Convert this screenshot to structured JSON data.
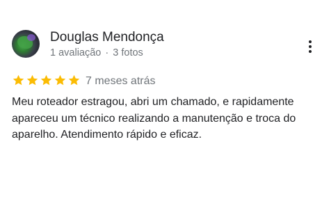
{
  "reviewer": {
    "name": "Douglas Mendonça",
    "reviews": "1 avaliação",
    "separator": "·",
    "photos": "3 fotos"
  },
  "rating": {
    "stars": 5,
    "max": 5,
    "star_color": "#fbbc04"
  },
  "review": {
    "time": "7 meses atrás",
    "text": "Meu roteador estragou, abri um chamado, e rapidamente apareceu um técnico realizando a manutenção e troca do aparelho. Atendimento rápido e eficaz."
  },
  "icons": {
    "more": "more-vert-icon",
    "star": "star-icon"
  }
}
